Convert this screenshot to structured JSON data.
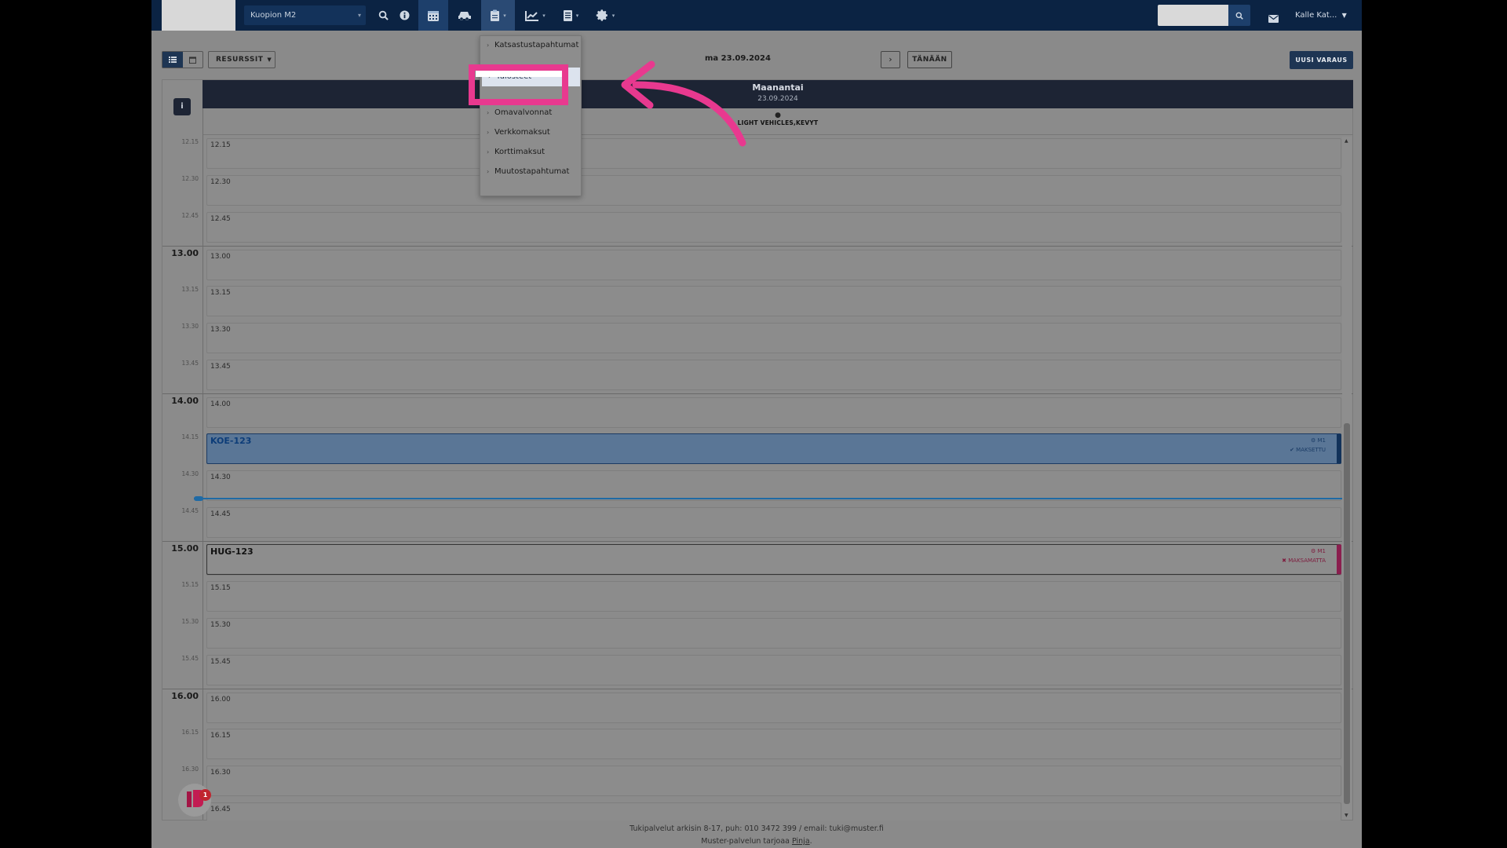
{
  "navbar": {
    "location": "Kuopion M2",
    "user": "Kalle Kat...",
    "icons": [
      "search-icon",
      "info-icon",
      "calendar-icon",
      "car-icon",
      "clipboard-icon",
      "chart-icon",
      "document-icon",
      "gear-icon"
    ]
  },
  "toolbar": {
    "resources_label": "RESURSSIT",
    "date_label": "ma 23.09.2024",
    "next_label": "›",
    "today_label": "TÄNÄÄN",
    "new_booking_label": "UUSI VARAUS"
  },
  "calendar": {
    "day_name": "Maanantai",
    "day_date": "23.09.2024",
    "resource_name": "LIGHT VEHICLES,KEVYT",
    "info_label": "i",
    "slots": [
      {
        "label": "12.15",
        "cell": "12.15",
        "hour": false
      },
      {
        "label": "12.30",
        "cell": "12.30",
        "hour": false
      },
      {
        "label": "12.45",
        "cell": "12.45",
        "hour": false
      },
      {
        "label": "13.00",
        "cell": "13.00",
        "hour": true
      },
      {
        "label": "13.15",
        "cell": "13.15",
        "hour": false
      },
      {
        "label": "13.30",
        "cell": "13.30",
        "hour": false
      },
      {
        "label": "13.45",
        "cell": "13.45",
        "hour": false
      },
      {
        "label": "14.00",
        "cell": "14.00",
        "hour": true
      },
      {
        "label": "14.15",
        "cell": "",
        "hour": false
      },
      {
        "label": "14.30",
        "cell": "14.30",
        "hour": false
      },
      {
        "label": "14.45",
        "cell": "14.45",
        "hour": false
      },
      {
        "label": "15.00",
        "cell": "",
        "hour": true
      },
      {
        "label": "15.15",
        "cell": "15.15",
        "hour": false
      },
      {
        "label": "15.30",
        "cell": "15.30",
        "hour": false
      },
      {
        "label": "15.45",
        "cell": "15.45",
        "hour": false
      },
      {
        "label": "16.00",
        "cell": "16.00",
        "hour": true
      },
      {
        "label": "16.15",
        "cell": "16.15",
        "hour": false
      },
      {
        "label": "16.30",
        "cell": "16.30",
        "hour": false
      },
      {
        "label": "",
        "cell": "16.45",
        "hour": false
      }
    ],
    "bookings": {
      "paid": {
        "plate": "KOE-123",
        "resource": "⚙ M1",
        "status": "✔ MAKSETTU"
      },
      "unpaid": {
        "plate": "HUG-123",
        "resource": "⚙ M1",
        "status": "✖ MAKSAMATTA"
      }
    }
  },
  "dropdown": {
    "items": [
      {
        "label": "Katsastustapahtumat"
      },
      {
        "label": "Tulosteet"
      },
      {
        "label": "Omavalvonnat"
      },
      {
        "label": "Verkkomaksut"
      },
      {
        "label": "Korttimaksut"
      },
      {
        "label": "Muutostapahtumat"
      }
    ]
  },
  "footer": {
    "line1": "Tukipalvelut arkisin 8-17, puh: 010 3472 399 / email: tuki@muster.fi",
    "line2_prefix": "Muster-palvelun tarjoaa ",
    "line2_link": "Pinja",
    "line2_suffix": "."
  },
  "chat": {
    "badge": "1"
  },
  "colors": {
    "navbar": "#0b2343",
    "accent": "#e8398f",
    "paid": "#12325a",
    "unpaid": "#8a1e4e",
    "now_line": "#1f6aa5"
  }
}
